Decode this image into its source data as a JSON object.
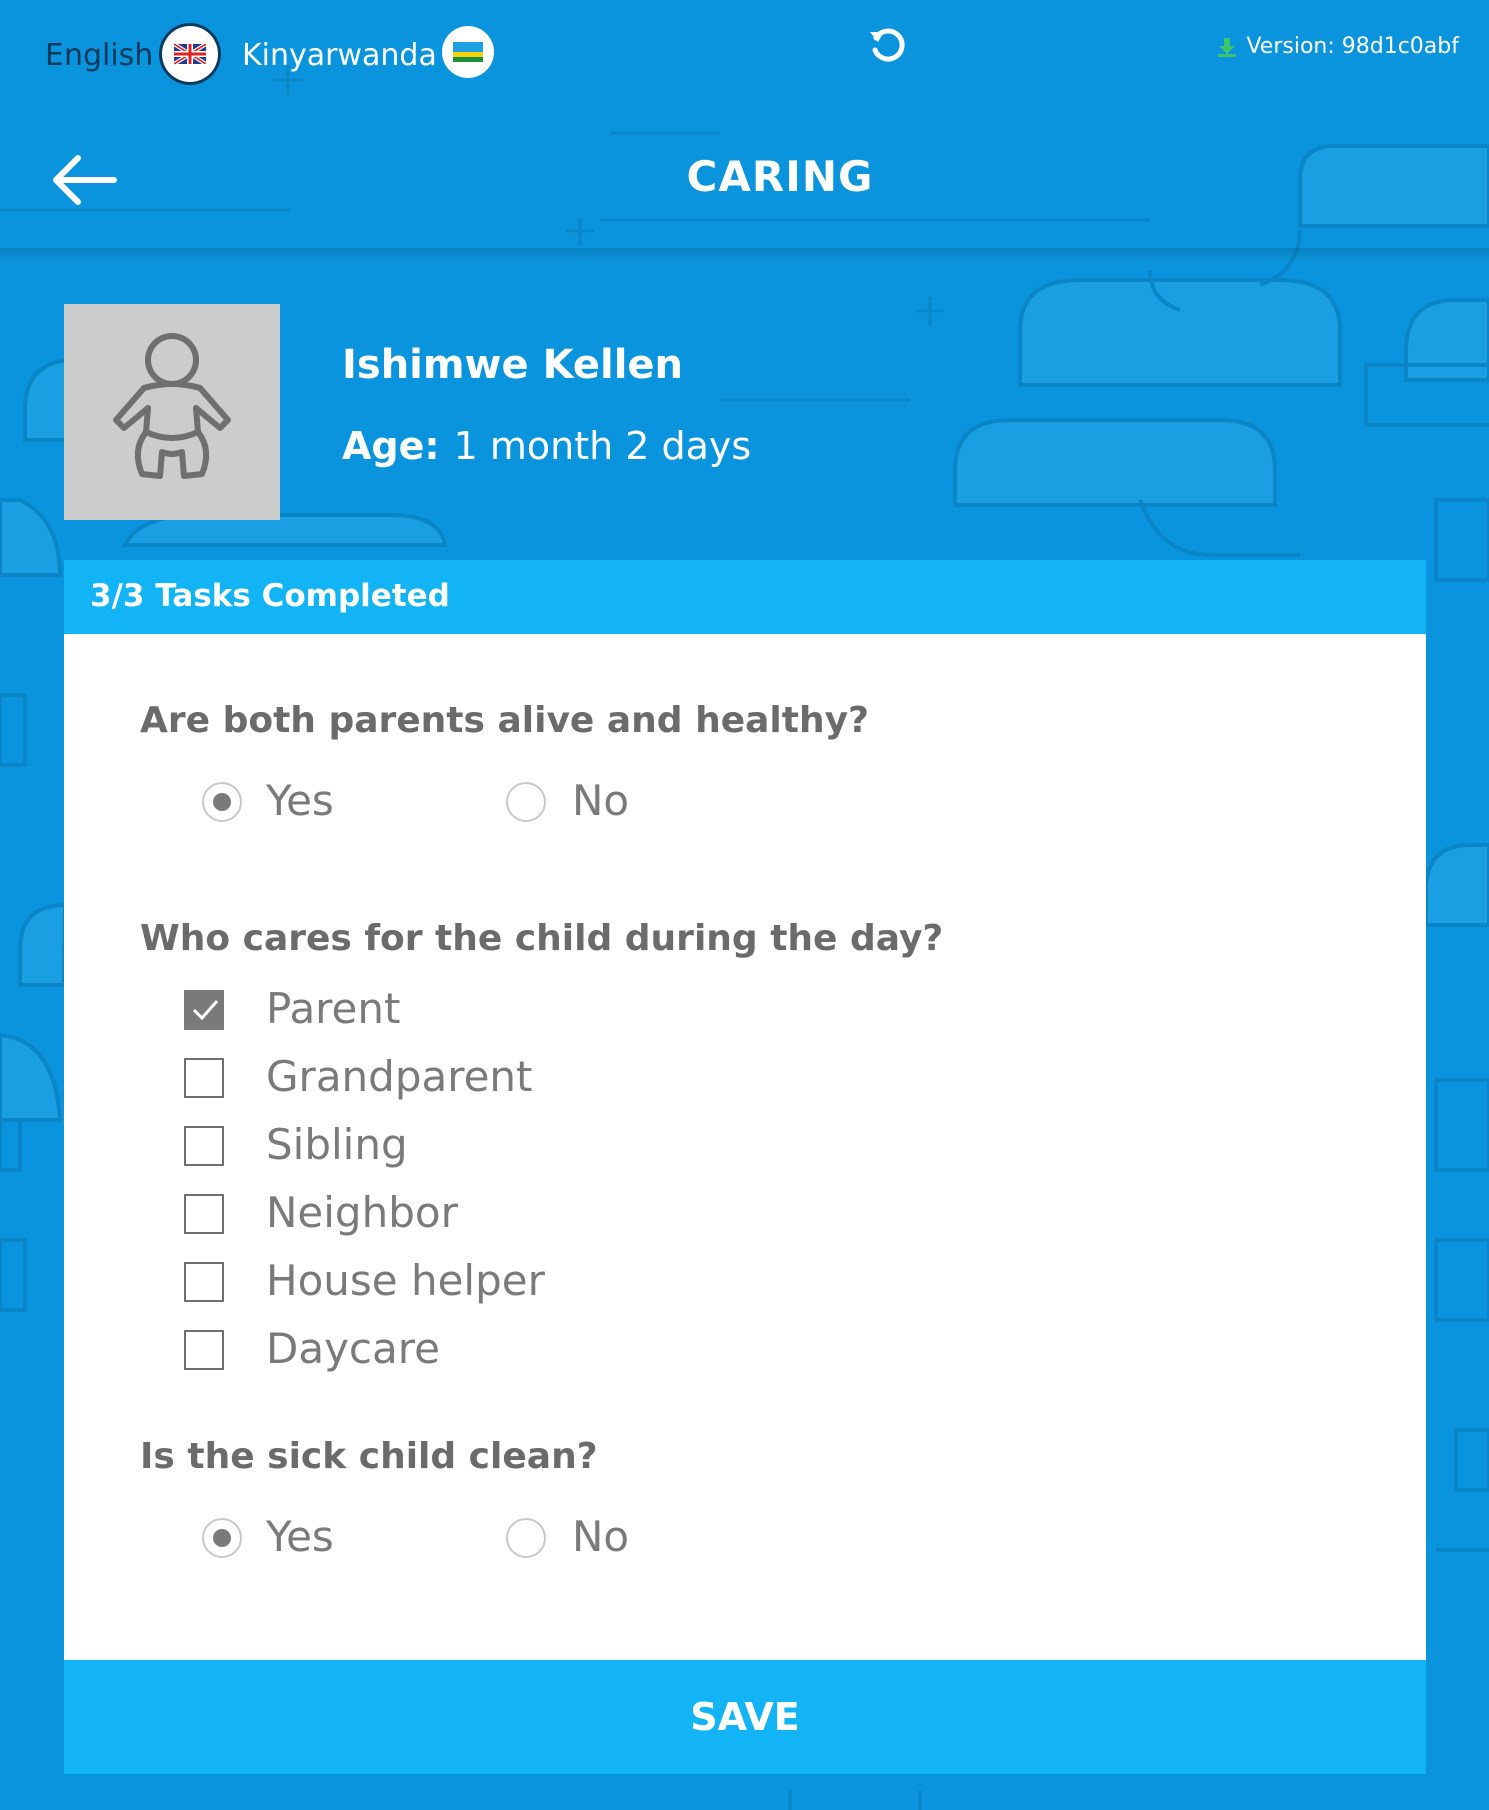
{
  "topbar": {
    "lang_english": "English",
    "lang_kinyarwanda": "Kinyarwanda",
    "version": "Version: 98d1c0abf"
  },
  "header": {
    "title": "CARING"
  },
  "child": {
    "name": "Ishimwe Kellen",
    "age_label": "Age:",
    "age_value": "1 month 2 days"
  },
  "tasks": {
    "status": "3/3 Tasks Completed"
  },
  "form": {
    "q1": {
      "text": "Are both parents alive and healthy?",
      "options": [
        "Yes",
        "No"
      ],
      "selected": "Yes"
    },
    "q2": {
      "text": "Who cares for the child during the day?",
      "options": [
        "Parent",
        "Grandparent",
        "Sibling",
        "Neighbor",
        "House helper",
        "Daycare"
      ],
      "checked": [
        "Parent"
      ]
    },
    "q3": {
      "text": "Is the sick child clean?",
      "options": [
        "Yes",
        "No"
      ],
      "selected": "Yes"
    }
  },
  "actions": {
    "save": "SAVE"
  },
  "colors": {
    "background": "#0a94dd",
    "accent": "#12b4f6",
    "text_grey": "#6b6b6b"
  }
}
